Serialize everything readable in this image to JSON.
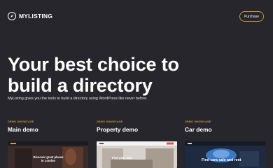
{
  "brand": {
    "name": "MYLISTING",
    "logo_icon": "compass-icon"
  },
  "header": {
    "purchase_label": "Purchase"
  },
  "hero": {
    "title": "Your best choice to build a directory",
    "subtitle": "MyListing gives you the tools to build a directory using WordPress like never before."
  },
  "demos": [
    {
      "tag": "DEMO SHOWCASE",
      "name": "Main demo",
      "caption": "Discover great places in London"
    },
    {
      "tag": "DEMO SHOWCASE",
      "name": "Property demo",
      "caption": "Find your next"
    },
    {
      "tag": "DEMO SHOWCASE",
      "name": "Car demo",
      "caption": "Find cars sale and rent"
    }
  ],
  "colors": {
    "background": "#26262c",
    "accent": "#c9973a",
    "text": "#ffffff"
  }
}
